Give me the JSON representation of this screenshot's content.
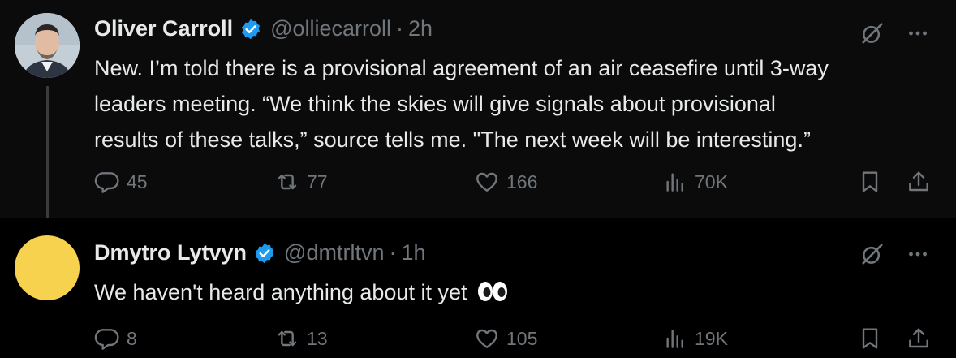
{
  "tweets": [
    {
      "author": "Oliver Carroll",
      "handle": "@olliecarroll",
      "time": "2h",
      "separator": "·",
      "text_lines": [
        "New. I’m told there is a provisional agreement of an air ceasefire until 3-way",
        "leaders meeting. “We think the skies will give signals about provisional",
        "results of these talks,” source tells me. \"The next week will be interesting.”"
      ],
      "replies": "45",
      "retweets": "77",
      "likes": "166",
      "views": "70K",
      "avatar": "photo-avatar"
    },
    {
      "author": "Dmytro Lytvyn",
      "handle": "@dmtrltvn",
      "time": "1h",
      "separator": "·",
      "text": "We haven't heard anything about it yet",
      "emoji": "eyes-emoji",
      "replies": "8",
      "retweets": "13",
      "likes": "105",
      "views": "19K",
      "avatar": "yellow-circle-avatar"
    }
  ],
  "colors": {
    "background": "#000000",
    "text": "#e7e9ea",
    "secondary": "#71767b",
    "verified": "#1d9bf0",
    "avatar2": "#f6d24f"
  },
  "icons": [
    "verified-badge-icon",
    "grok-icon",
    "more-icon",
    "reply-icon",
    "retweet-icon",
    "like-icon",
    "views-icon",
    "bookmark-icon",
    "share-icon"
  ]
}
